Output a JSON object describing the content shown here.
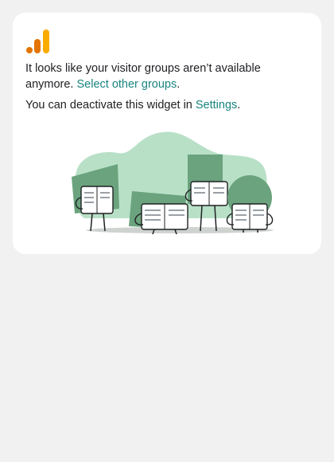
{
  "card": {
    "line1_text": "It looks like your visitor groups aren’t available anymore.",
    "line1_link": "Select other groups",
    "line1_end": ".",
    "line2_text": "You can deactivate this widget in",
    "line2_link": "Settings",
    "line2_end": "."
  },
  "icons": {
    "logo": "analytics-logo-icon",
    "illustration": "people-reading-newspapers-illustration"
  },
  "colors": {
    "link": "#1a8480",
    "logo_orange": "#f9ab00",
    "logo_dark_orange": "#e37400",
    "illustration_green": "#6aa37d",
    "illustration_light_green": "#b8e0c7"
  }
}
